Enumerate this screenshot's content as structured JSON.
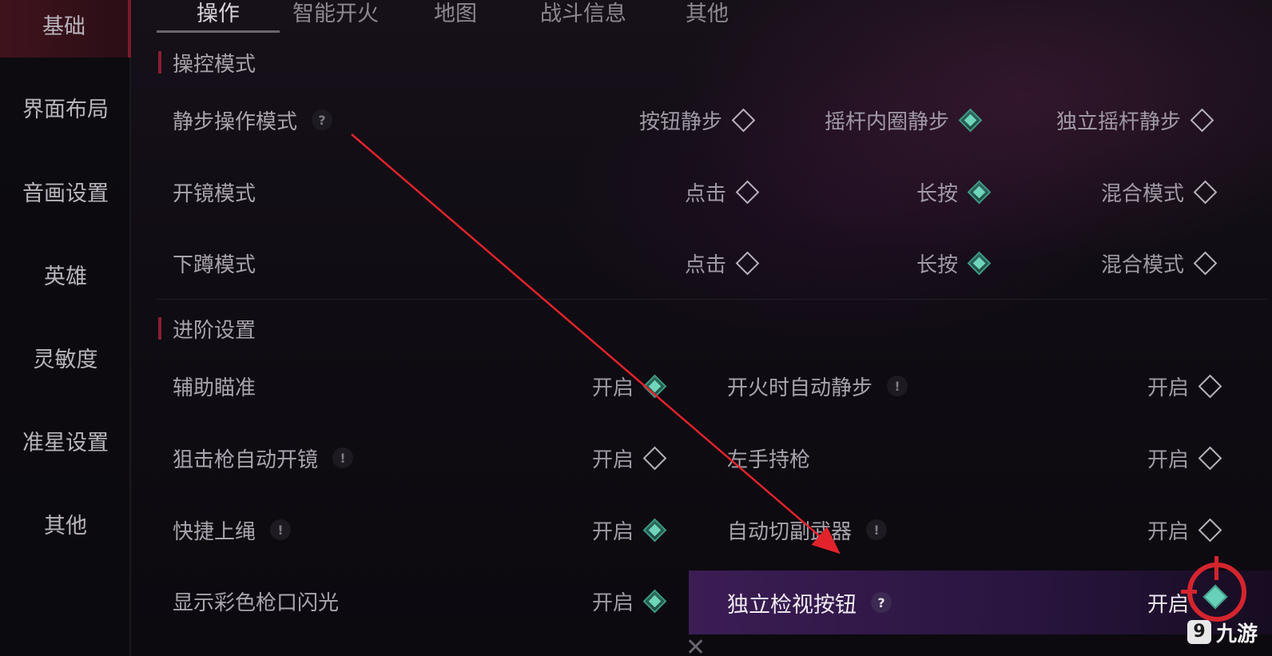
{
  "sidebar": {
    "items": [
      {
        "label": "基础",
        "active": true
      },
      {
        "label": "界面布局"
      },
      {
        "label": "音画设置"
      },
      {
        "label": "英雄"
      },
      {
        "label": "灵敏度"
      },
      {
        "label": "准星设置"
      },
      {
        "label": "其他"
      }
    ]
  },
  "tabs": [
    {
      "label": "操作",
      "active": true
    },
    {
      "label": "智能开火"
    },
    {
      "label": "地图"
    },
    {
      "label": "战斗信息"
    },
    {
      "label": "其他"
    }
  ],
  "sections": {
    "control_mode": {
      "title": "操控模式",
      "rows": [
        {
          "label": "静步操作模式",
          "help": "?",
          "options": [
            {
              "label": "按钮静步",
              "selected": false
            },
            {
              "label": "摇杆内圈静步",
              "selected": true
            },
            {
              "label": "独立摇杆静步",
              "selected": false
            }
          ]
        },
        {
          "label": "开镜模式",
          "options": [
            {
              "label": "点击",
              "selected": false
            },
            {
              "label": "长按",
              "selected": true
            },
            {
              "label": "混合模式",
              "selected": false
            }
          ]
        },
        {
          "label": "下蹲模式",
          "options": [
            {
              "label": "点击",
              "selected": false
            },
            {
              "label": "长按",
              "selected": true
            },
            {
              "label": "混合模式",
              "selected": false
            }
          ]
        }
      ]
    },
    "advanced": {
      "title": "进阶设置",
      "left": [
        {
          "label": "辅助瞄准",
          "value": "开启",
          "on": true
        },
        {
          "label": "狙击枪自动开镜",
          "help": "!",
          "value": "开启",
          "on": false
        },
        {
          "label": "快捷上绳",
          "help": "!",
          "value": "开启",
          "on": true
        },
        {
          "label": "显示彩色枪口闪光",
          "value": "开启",
          "on": true
        }
      ],
      "right": [
        {
          "label": "开火时自动静步",
          "help": "!",
          "value": "开启",
          "on": false
        },
        {
          "label": "左手持枪",
          "value": "开启",
          "on": false
        },
        {
          "label": "自动切副武器",
          "help": "!",
          "value": "开启",
          "on": false
        },
        {
          "label": "独立检视按钮",
          "help": "?",
          "value": "开启",
          "on": true,
          "highlighted": true
        }
      ]
    }
  },
  "watermark": {
    "text": "九游"
  },
  "colors": {
    "accent_red": "#d4252e",
    "selected_teal": "#66d0b8",
    "highlight_purple": "#3e1e58"
  }
}
